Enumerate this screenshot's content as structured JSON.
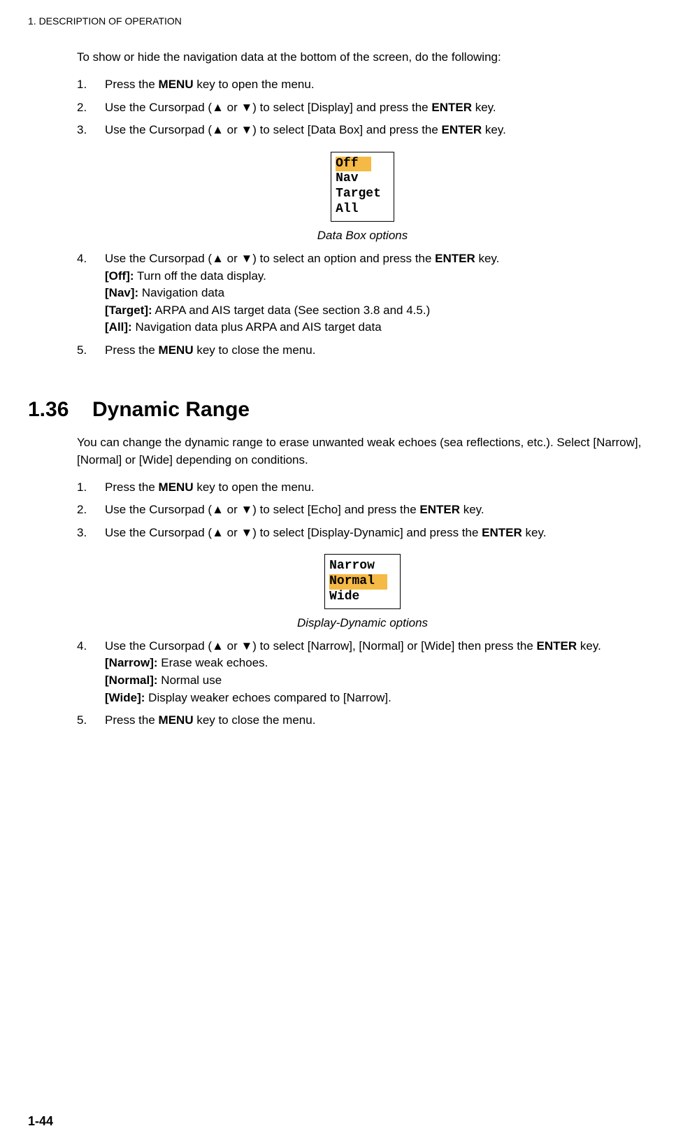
{
  "header": "1.  DESCRIPTION OF OPERATION",
  "intro": "To show or hide the navigation data at the bottom of the screen, do the following:",
  "list1": {
    "i1": {
      "n": "1.",
      "a": "Press the ",
      "b": "MENU",
      "c": " key to open the menu."
    },
    "i2": {
      "n": "2.",
      "a": "Use the Cursorpad (",
      "b": " or ",
      "c": ") to select [Display] and press the ",
      "d": "ENTER",
      "e": " key."
    },
    "i3": {
      "n": "3.",
      "a": "Use the Cursorpad (",
      "b": " or ",
      "c": ") to select [Data Box] and press the ",
      "d": "ENTER",
      "e": " key."
    },
    "i4": {
      "n": "4.",
      "a": "Use the Cursorpad (",
      "b": " or ",
      "c": ") to select an option and press the ",
      "d": "ENTER",
      "e": " key.",
      "off_l": "[Off]:",
      "off_t": " Turn off the data display.",
      "nav_l": "[Nav]:",
      "nav_t": " Navigation data",
      "tgt_l": "[Target]:",
      "tgt_t": " ARPA and AIS target data (See section 3.8 and 4.5.)",
      "all_l": "[All]:",
      "all_t": " Navigation data plus ARPA and AIS target data"
    },
    "i5": {
      "n": "5.",
      "a": "Press the ",
      "b": "MENU",
      "c": " key to close the menu."
    }
  },
  "fig1": {
    "opt1": "Off",
    "opt2": "Nav",
    "opt3": "Target",
    "opt4": "All",
    "caption": "Data Box options"
  },
  "section": {
    "num": "1.36",
    "title": "Dynamic Range",
    "body": "You can change the dynamic range to erase unwanted weak echoes (sea reflections, etc.). Select [Narrow], [Normal] or [Wide] depending on conditions."
  },
  "list2": {
    "i1": {
      "n": "1.",
      "a": "Press the ",
      "b": "MENU",
      "c": " key to open the menu."
    },
    "i2": {
      "n": "2.",
      "a": "Use the Cursorpad (",
      "b": " or ",
      "c": ") to select [Echo] and press the ",
      "d": "ENTER",
      "e": " key."
    },
    "i3": {
      "n": "3.",
      "a": "Use the Cursorpad (",
      "b": " or ",
      "c": ") to select [Display-Dynamic] and press the ",
      "d": "ENTER",
      "e": " key."
    },
    "i4": {
      "n": "4.",
      "a": "Use the Cursorpad (",
      "b": " or ",
      "c": ") to select [Narrow], [Normal] or [Wide] then press the ",
      "d": "ENTER",
      "e": " key.",
      "nar_l": "[Narrow]:",
      "nar_t": " Erase weak echoes.",
      "nor_l": "[Normal]:",
      "nor_t": " Normal use",
      "wid_l": "[Wide]:",
      "wid_t": " Display weaker echoes compared to [Narrow]."
    },
    "i5": {
      "n": "5.",
      "a": "Press the ",
      "b": "MENU",
      "c": " key to close the menu."
    }
  },
  "fig2": {
    "opt1": "Narrow",
    "opt2": "Normal",
    "opt3": "Wide",
    "caption": "Display-Dynamic options"
  },
  "tri_up": "▲",
  "tri_dn": "▼",
  "page": "1-44"
}
